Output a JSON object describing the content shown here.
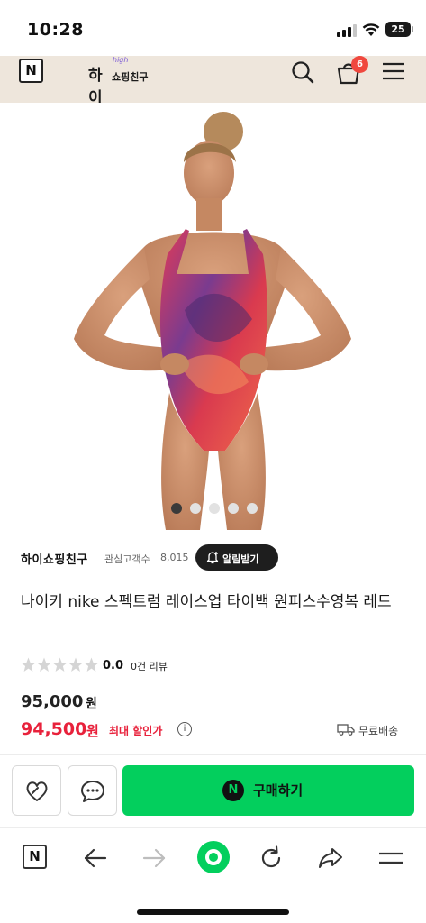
{
  "status_bar": {
    "time": "10:28",
    "battery": "25"
  },
  "header": {
    "naver_logo": "N",
    "shop_logo_main": "하이",
    "shop_logo_high": "high",
    "shop_logo_sub": "쇼핑친구",
    "cart_count": "6",
    "icons": [
      "naver-logo",
      "search-icon",
      "cart-icon",
      "hamburger-menu-icon"
    ]
  },
  "carousel": {
    "total": 5,
    "active": 0
  },
  "store": {
    "name": "하이쇼핑친구",
    "follower_label": "관심고객수",
    "follower_count": "8,015",
    "alert_button": "알림받기"
  },
  "product": {
    "title": "나이키 nike 스펙트럼 레이스업 타이백 원피스수영복 레드",
    "rating": {
      "stars": 0,
      "score": "0.0",
      "review_count": "0건 리뷰"
    },
    "original_price": "95,000",
    "original_unit": "원",
    "sale_price": "94,500",
    "sale_unit": "원",
    "discount_label": "최대 할인가",
    "info_mark": "i",
    "shipping": "무료배송"
  },
  "actions": {
    "buy_label": "구매하기",
    "npay_mark": "N"
  },
  "browser_bar": {
    "naver_logo": "N",
    "icons": [
      "naver-logo",
      "back-icon",
      "forward-icon",
      "green-dot-icon",
      "refresh-icon",
      "share-icon",
      "menu-icon"
    ]
  },
  "colors": {
    "header_bg": "#eee6dc",
    "badge": "#f0483e",
    "sale": "#e8213b",
    "buy": "#03cf5d"
  }
}
